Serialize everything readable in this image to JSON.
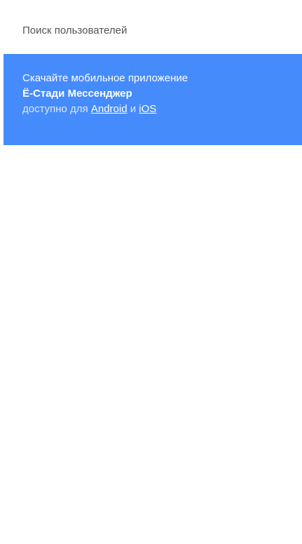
{
  "search": {
    "placeholder": "Поиск пользователей"
  },
  "promo": {
    "line1": "Скачайте мобильное приложение",
    "app_name": "Ё-Стади Мессенджер",
    "available_prefix": "доступно для",
    "android_link": "Android",
    "conjunction": "и",
    "ios_link": "iOS",
    "background_color": "#468bfb"
  }
}
